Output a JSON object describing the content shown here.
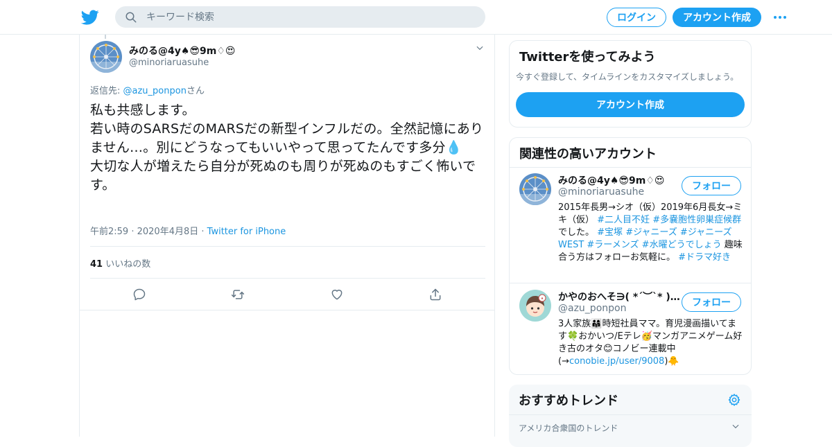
{
  "header": {
    "search_placeholder": "キーワード検索",
    "login_label": "ログイン",
    "signup_label": "アカウント作成"
  },
  "tweet": {
    "author_name": "みのる@4y♠😎9m♢😍",
    "author_handle": "@minoriaruasuhe",
    "reply_prefix": "返信先: ",
    "reply_to": "@azu_ponpon",
    "reply_suffix": "さん",
    "text": "私も共感します。\n若い時のSARSだのMARSだの新型インフルだの。全然記憶にありません…。別にどうなってもいいやって思ってたんです多分💧\n大切な人が増えたら自分が死ぬのも周りが死ぬのもすごく怖いです。",
    "time": "午前2:59",
    "date": "2020年4月8日",
    "source": "Twitter for iPhone",
    "likes_count": "41",
    "likes_label": "いいねの数"
  },
  "signup_card": {
    "title": "Twitterを使ってみよう",
    "subtitle": "今すぐ登録して、タイムラインをカスタマイズしましょう。",
    "button": "アカウント作成"
  },
  "related": {
    "title": "関連性の高いアカウント",
    "accounts": [
      {
        "name": "みのる@4y♠😎9m♢😍",
        "handle": "@minoriaruasuhe",
        "follow": "フォロー",
        "bio_1": "2015年長男→シオ（仮）2019年6月長女→ミキ（仮） ",
        "tag_1": "#二人目不妊",
        "tag_2": "#多嚢胞性卵巣症候群",
        "bio_2": " でした。 ",
        "tag_3": "#宝塚",
        "tag_4": "#ジャニーズ",
        "tag_5": "#ジャニーズWEST",
        "tag_6": "#ラーメンズ",
        "tag_7": "#水曜どうでしょう",
        "bio_3": " 趣味合う方はフォローお気軽に。 ",
        "tag_8": "#ドラマ好き"
      },
      {
        "name": "かやのおへそ∋( *´︶`* )…",
        "handle": "@azu_ponpon",
        "follow": "フォロー",
        "bio_1": "3人家族👨‍👩‍👧時短社員ママ。育児漫画描いてます🍀おかいつ/Eテレ🥳マンガアニメゲーム好き古のオタ😊コノビー連載中(→",
        "link": "conobie.jp/user/9008",
        "bio_2": ")🐥"
      }
    ]
  },
  "trends": {
    "title": "おすすめトレンド",
    "location": "アメリカ合衆国のトレンド"
  },
  "colors": {
    "accent": "#1da1f2",
    "link": "#1b95e0",
    "secondary_text": "#657786",
    "border": "#e6ecf0"
  },
  "icons": [
    "twitter-bird-icon",
    "search-icon",
    "more-dots-icon",
    "chevron-down-icon",
    "reply-icon",
    "retweet-icon",
    "like-heart-icon",
    "share-icon",
    "gear-icon"
  ]
}
